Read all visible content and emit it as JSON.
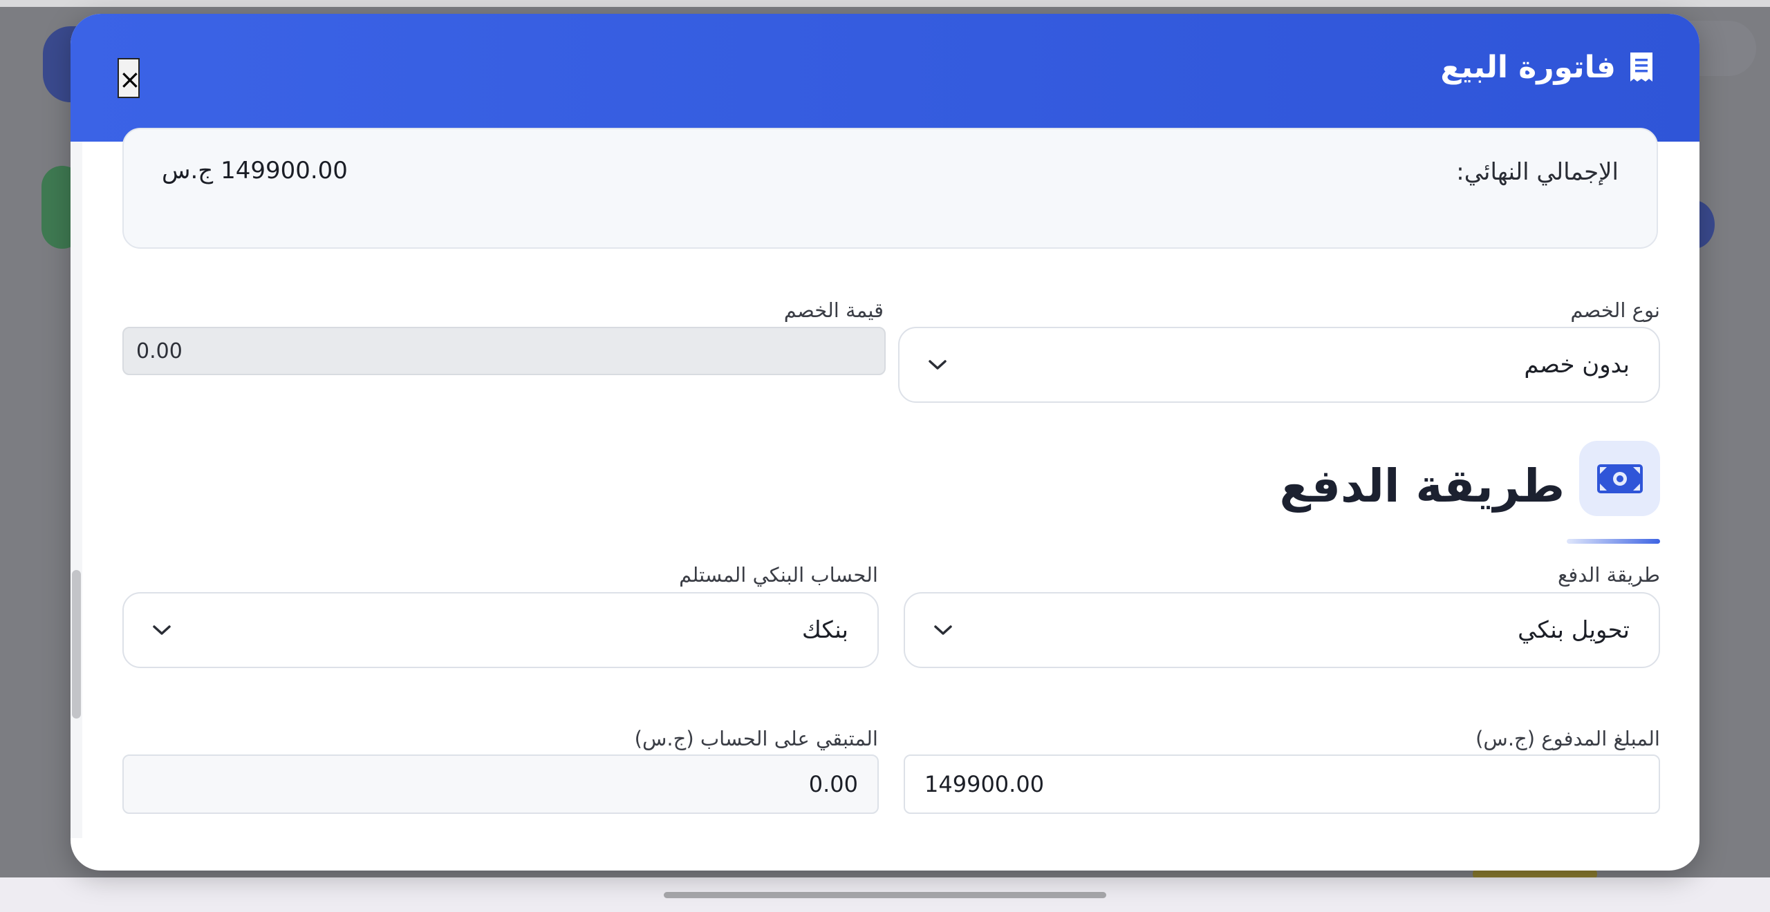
{
  "modal": {
    "title": "فاتورة البيع",
    "close_label": "×"
  },
  "summary": {
    "total_label": "الإجمالي النهائي:",
    "total_value": "149900.00 ج.س"
  },
  "discount": {
    "type_label": "نوع الخصم",
    "type_value": "بدون خصم",
    "value_label": "قيمة الخصم",
    "value": "0.00"
  },
  "payment": {
    "section_title": "طريقة الدفع",
    "method_label": "طريقة الدفع",
    "method_value": "تحويل بنكي",
    "bank_account_label": "الحساب البنكي المستلم",
    "bank_account_value": "بنكك",
    "paid_label": "المبلغ المدفوع (ج.س)",
    "paid_value": "149900.00",
    "remaining_label": "المتبقي على الحساب (ج.س)",
    "remaining_value": "0.00"
  },
  "colors": {
    "header": "#3b63e6",
    "accent": "#3e64e3",
    "money_tile": "#e5ebfc"
  },
  "icons": {
    "header": "receipt-icon",
    "section": "money-icon",
    "select": "chevron-down-icon"
  }
}
